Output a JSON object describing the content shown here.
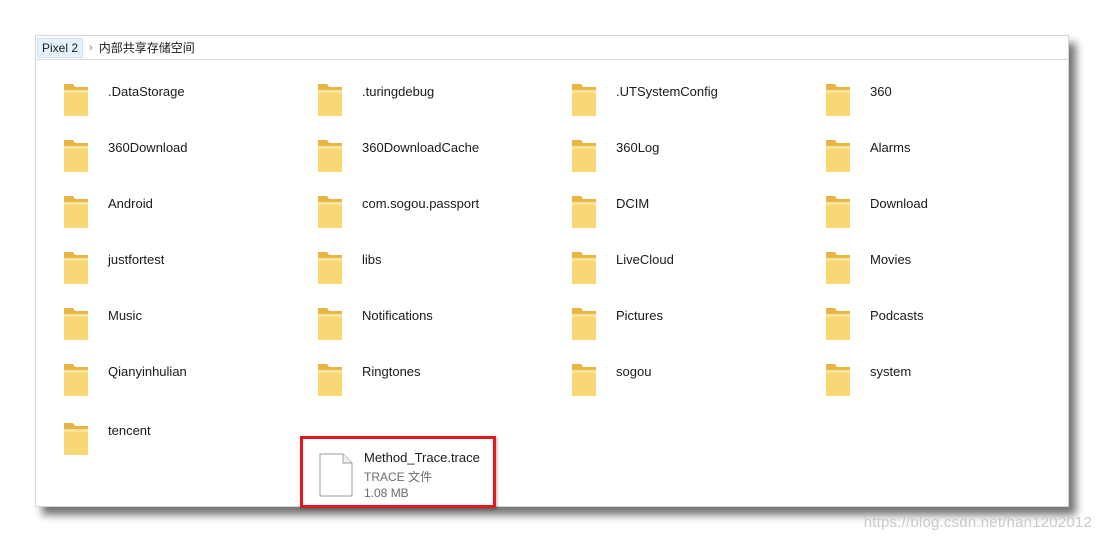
{
  "breadcrumb": {
    "device": "Pixel 2",
    "separator": "›",
    "current": "内部共享存储空间"
  },
  "folders": [
    {
      "name": ".DataStorage"
    },
    {
      "name": ".turingdebug"
    },
    {
      "name": ".UTSystemConfig"
    },
    {
      "name": "360"
    },
    {
      "name": "360Download"
    },
    {
      "name": "360DownloadCache"
    },
    {
      "name": "360Log"
    },
    {
      "name": "Alarms"
    },
    {
      "name": "Android"
    },
    {
      "name": "com.sogou.passport"
    },
    {
      "name": "DCIM"
    },
    {
      "name": "Download"
    },
    {
      "name": "justfortest"
    },
    {
      "name": "libs"
    },
    {
      "name": "LiveCloud"
    },
    {
      "name": "Movies"
    },
    {
      "name": "Music"
    },
    {
      "name": "Notifications"
    },
    {
      "name": "Pictures"
    },
    {
      "name": "Podcasts"
    },
    {
      "name": "Qianyinhulian"
    },
    {
      "name": "Ringtones"
    },
    {
      "name": "sogou"
    },
    {
      "name": "system"
    },
    {
      "name": "tencent"
    }
  ],
  "file": {
    "name": "Method_Trace.trace",
    "type": "TRACE 文件",
    "size": "1.08 MB",
    "highlight_color": "#e3171c"
  },
  "icons": {
    "folder": "folder-icon",
    "file": "file-icon",
    "separator": "chevron-right-icon"
  },
  "watermark": "https://blog.csdn.net/han1202012"
}
